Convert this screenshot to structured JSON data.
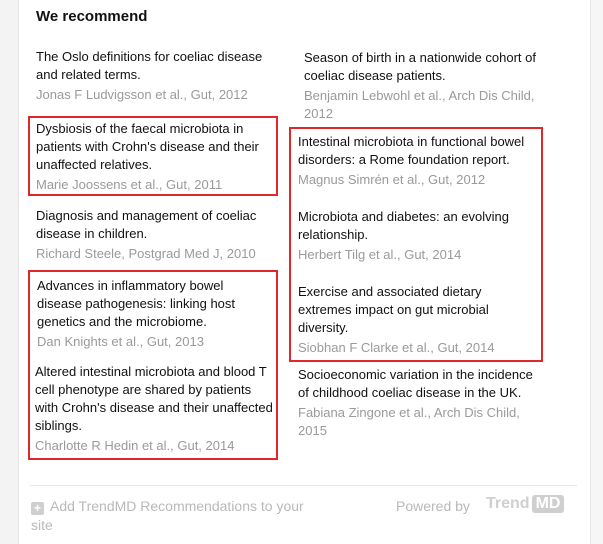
{
  "heading": "We recommend",
  "recommendations": [
    {
      "title": "The Oslo definitions for coeliac disease and related terms.",
      "meta": "Jonas F Ludvigsson et al., Gut, 2012"
    },
    {
      "title": "Season of birth in a nationwide cohort of coeliac disease patients.",
      "meta": "Benjamin Lebwohl et al., Arch Dis Child, 2012"
    },
    {
      "title": "Dysbiosis of the faecal microbiota in patients with Crohn's disease and their unaffected relatives.",
      "meta": "Marie Joossens et al., Gut, 2011"
    },
    {
      "title": "Intestinal microbiota in functional bowel disorders: a Rome foundation report.",
      "meta": "Magnus Simrén et al., Gut, 2012"
    },
    {
      "title": "Diagnosis and management of coeliac disease in children.",
      "meta": "Richard Steele, Postgrad Med J, 2010"
    },
    {
      "title": "Microbiota and diabetes: an evolving relationship.",
      "meta": "Herbert Tilg et al., Gut, 2014"
    },
    {
      "title": "Advances in inflammatory bowel disease pathogenesis: linking host genetics and the microbiome.",
      "meta": "Dan Knights et al., Gut, 2013"
    },
    {
      "title": "Exercise and associated dietary extremes impact on gut microbial diversity.",
      "meta": "Siobhan F Clarke et al., Gut, 2014"
    },
    {
      "title": "Altered intestinal microbiota and blood T cell phenotype are shared by patients with Crohn's disease and their unaffected siblings.",
      "meta": "Charlotte R Hedin et al., Gut, 2014"
    },
    {
      "title": "Socioeconomic variation in the incidence of childhood coeliac disease in the UK.",
      "meta": "Fabiana Zingone et al., Arch Dis Child, 2015"
    }
  ],
  "footer": {
    "add_label": "Add TrendMD Recommendations to your site",
    "powered_by": "Powered by",
    "logo_trend": "Trend",
    "logo_md": "MD"
  },
  "colors": {
    "highlight": "#e0282a",
    "meta_text": "#9a9a9a",
    "footer_text": "#b9b9b9"
  }
}
